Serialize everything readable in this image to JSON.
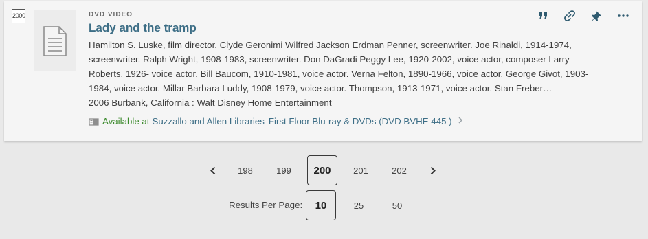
{
  "record": {
    "number": "2000",
    "type_label": "DVD VIDEO",
    "title": "Lady and the tramp",
    "authors": "Hamilton S. Luske, film director. Clyde Geronimi Wilfred Jackson Erdman Penner, screenwriter. Joe Rinaldi, 1914-1974, screenwriter. Ralph Wright, 1908-1983, screenwriter. Don DaGradi Peggy Lee, 1920-2002, voice actor, composer Larry Roberts, 1926- voice actor. Bill Baucom, 1910-1981, voice actor. Verna Felton, 1890-1966, voice actor. George Givot, 1903-1984, voice actor. Millar Barbara Luddy, 1908-1979, voice actor. Thompson, 1913-1971, voice actor. Stan Freber…",
    "publisher": "2006 Burbank, California : Walt Disney Home Entertainment",
    "availability": {
      "status": "Available at",
      "library": "Suzzallo and Allen Libraries",
      "location": "First Floor Blu-ray & DVDs (DVD BVHE 445 )",
      "status_color": "#3b8a2c",
      "link_color": "#3d6e86"
    },
    "actions": [
      {
        "icon": "citation-quote-icon"
      },
      {
        "icon": "permalink-chain-icon"
      },
      {
        "icon": "pin-icon"
      },
      {
        "icon": "more-options-icon"
      }
    ]
  },
  "pagination": {
    "pages": [
      "198",
      "199",
      "200",
      "201",
      "202"
    ],
    "current": "200"
  },
  "results_per_page": {
    "label": "Results Per Page:",
    "options": [
      "10",
      "25",
      "50"
    ],
    "current": "10"
  },
  "colors": {
    "accent": "#3d6e86",
    "available": "#3b8a2c",
    "background": "#e9e9e9",
    "card": "#f5f5f5"
  }
}
